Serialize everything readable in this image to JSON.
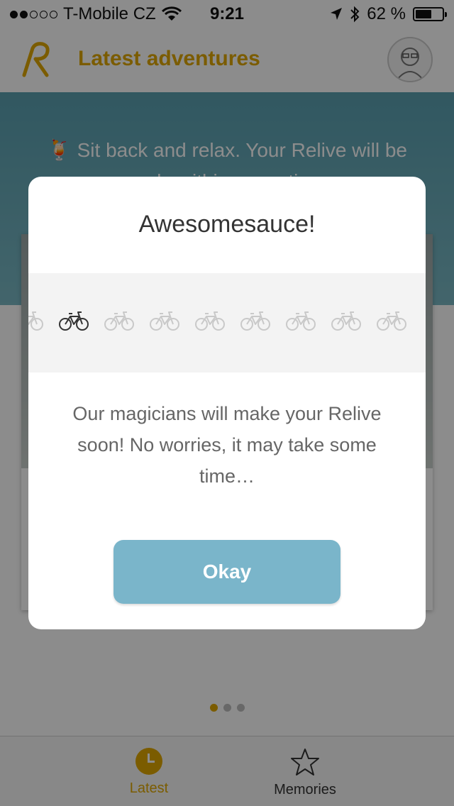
{
  "status_bar": {
    "carrier": "T-Mobile CZ",
    "time": "9:21",
    "battery": "62 %",
    "signal_bars_filled": 2,
    "signal_bars_total": 5
  },
  "nav": {
    "title": "Latest adventures"
  },
  "background": {
    "hero_text": "🍹 Sit back and relax. Your Relive will be made within some time."
  },
  "pager": {
    "pages": 3,
    "active": 0
  },
  "modal": {
    "title": "Awesomesauce!",
    "message": "Our magicians will make your Relive soon! No worries, it may take some time…",
    "button_label": "Okay",
    "bike_count": 9,
    "active_bike_index": 1
  },
  "tabs": [
    {
      "label": "Latest",
      "icon": "clock-icon",
      "active": true
    },
    {
      "label": "Memories",
      "icon": "star-icon",
      "active": false
    }
  ],
  "colors": {
    "accent": "#e0a800",
    "button": "#7ab5ca",
    "hero": "#5aa0b0"
  }
}
